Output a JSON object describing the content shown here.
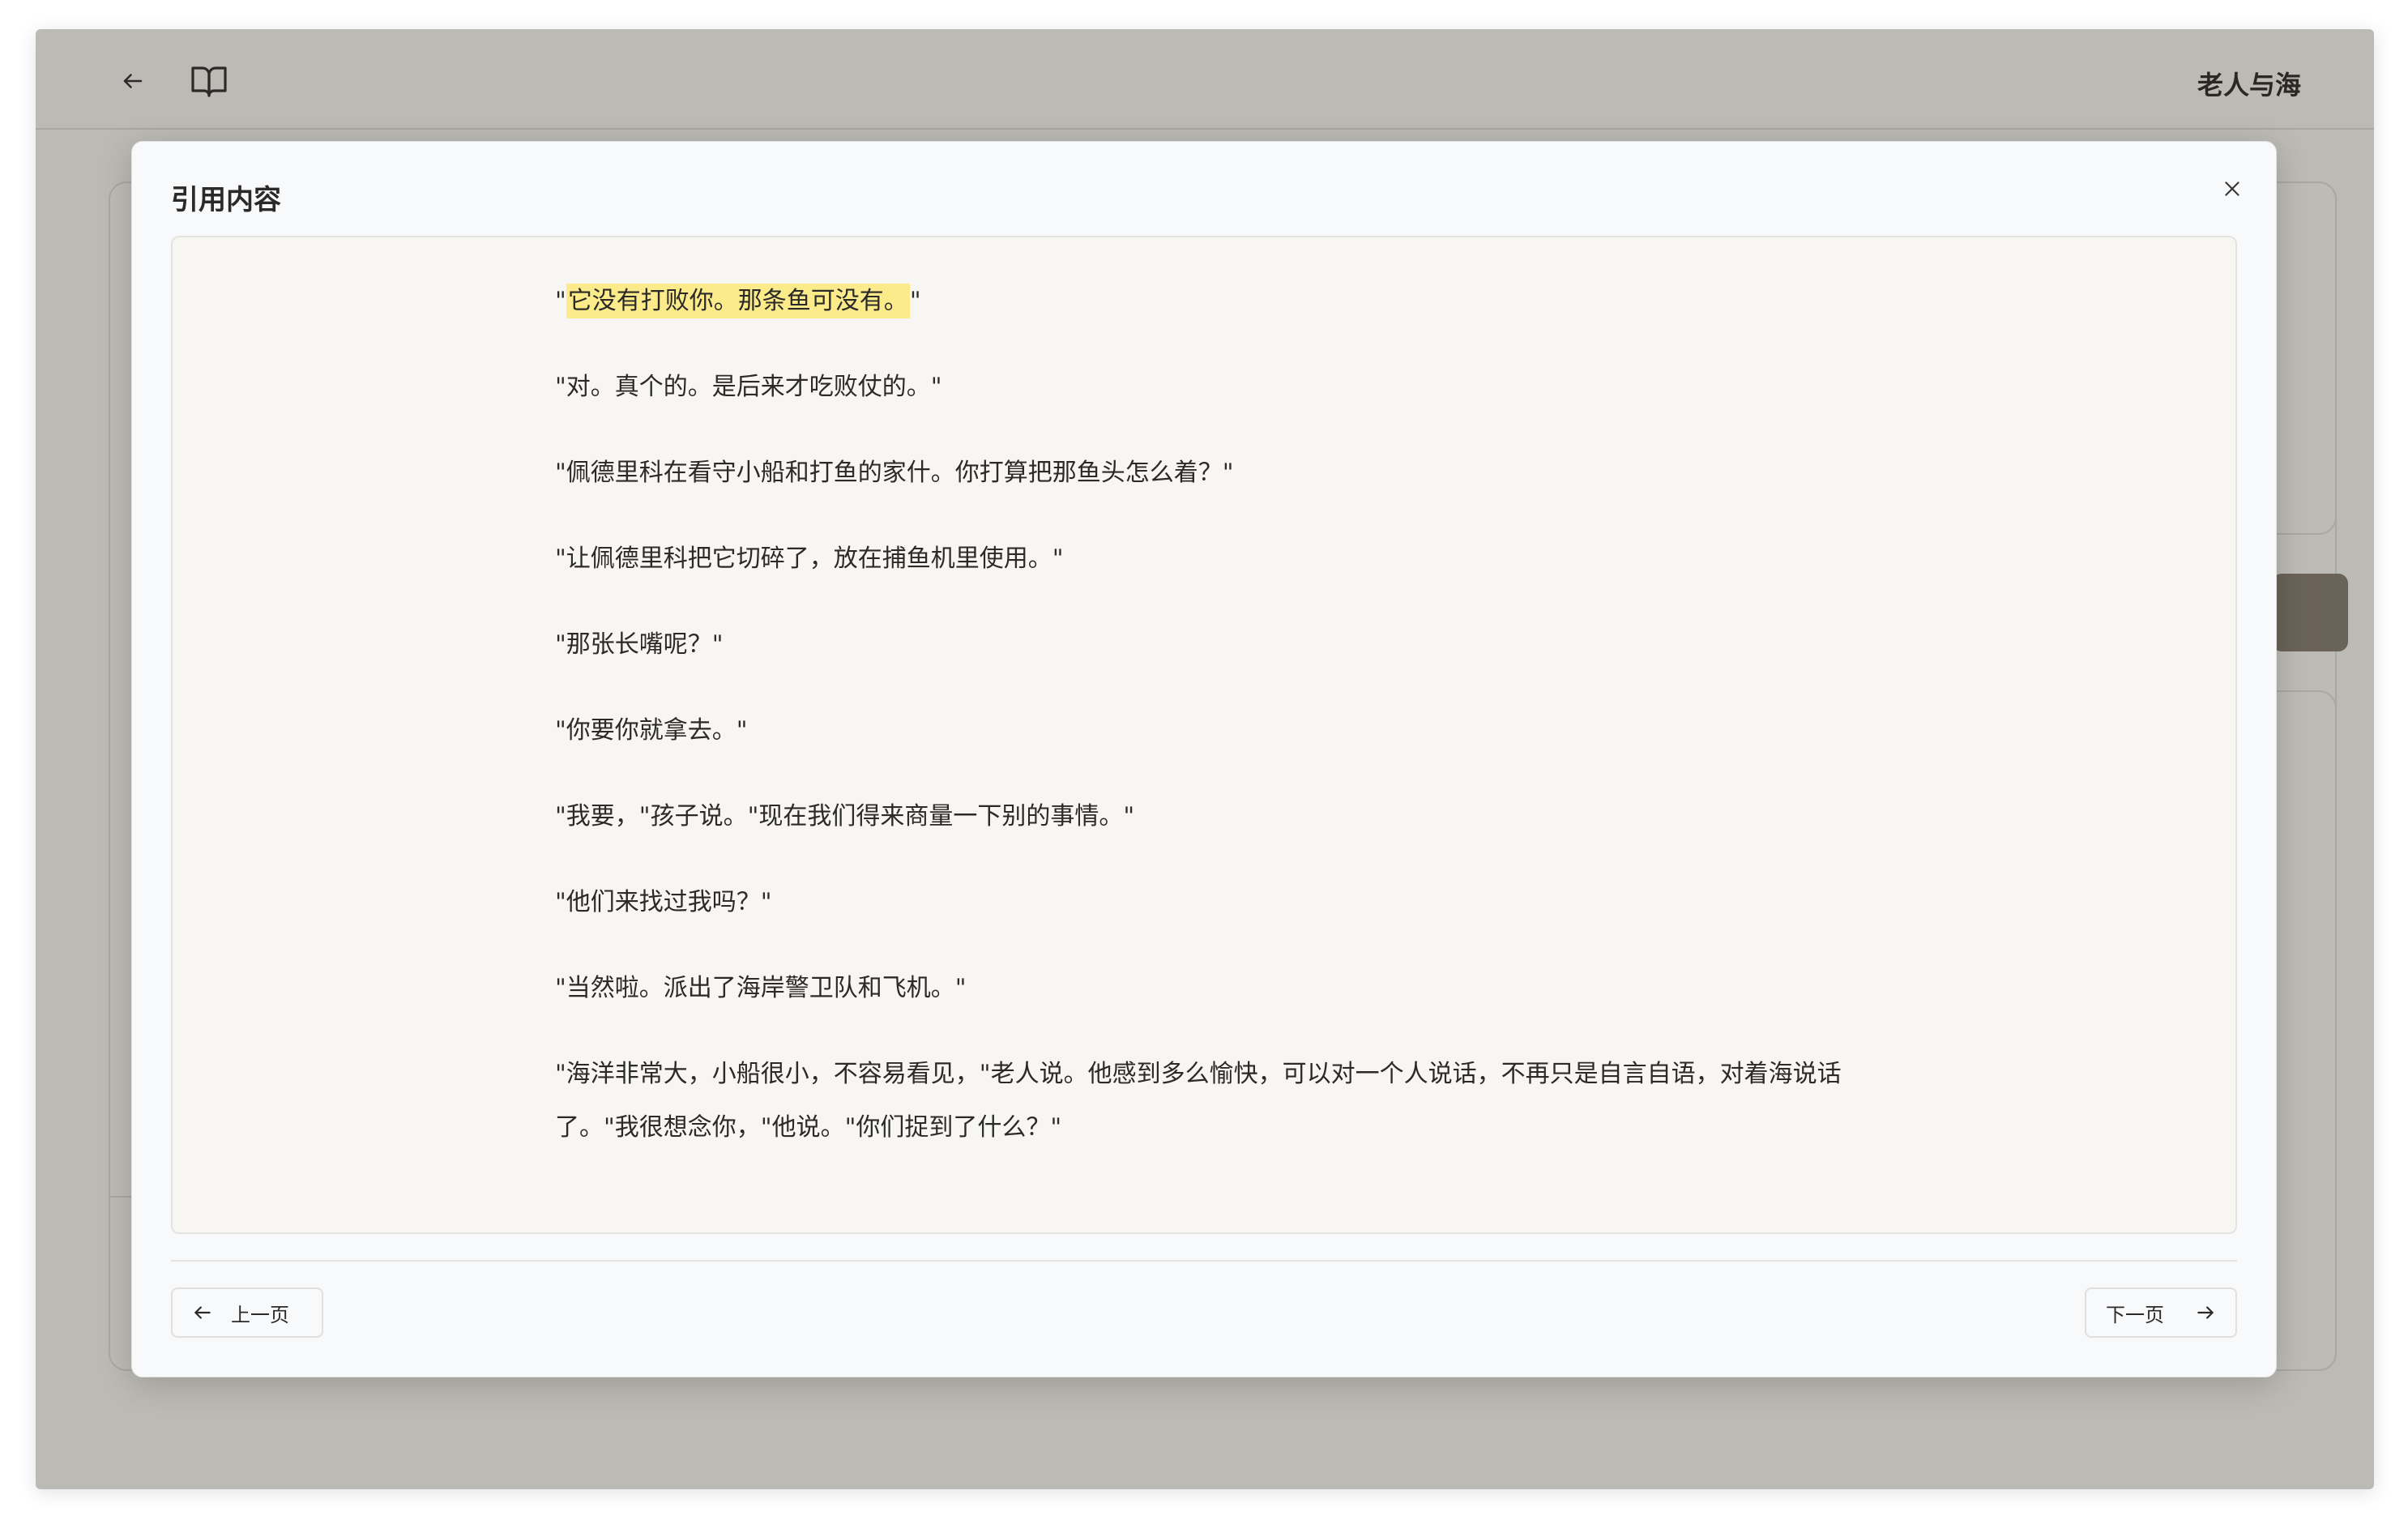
{
  "header": {
    "book_title": "老人与海"
  },
  "modal": {
    "title": "引用内容",
    "paragraphs": [
      {
        "before": "\"",
        "highlight": "它没有打败你。那条鱼可没有。",
        "after": "\""
      },
      {
        "text": "\"对。真个的。是后来才吃败仗的。\""
      },
      {
        "text": "\"佩德里科在看守小船和打鱼的家什。你打算把那鱼头怎么着？\""
      },
      {
        "text": "\"让佩德里科把它切碎了，放在捕鱼机里使用。\""
      },
      {
        "text": "\"那张长嘴呢？\""
      },
      {
        "text": "\"你要你就拿去。\""
      },
      {
        "text": "\"我要，\"孩子说。\"现在我们得来商量一下别的事情。\""
      },
      {
        "text": "\"他们来找过我吗？\""
      },
      {
        "text": "\"当然啦。派出了海岸警卫队和飞机。\""
      },
      {
        "text": "\"海洋非常大，小船很小，不容易看见，\"老人说。他感到多么愉快，可以对一个人说话，不再只是自言自语，对着海说话了。\"我很想念你，\"他说。\"你们捉到了什么？\""
      }
    ],
    "prev_label": "上一页",
    "next_label": "下一页"
  },
  "icons": {
    "back": "arrow-left-icon",
    "book": "book-open-icon",
    "close": "close-icon",
    "prev": "arrow-left-icon",
    "next": "arrow-right-icon"
  },
  "colors": {
    "highlight": "#fbeb8a",
    "overlay_bg": "#bcbab5",
    "modal_bg": "#f8f9fb",
    "content_bg": "#f7f6f2"
  }
}
